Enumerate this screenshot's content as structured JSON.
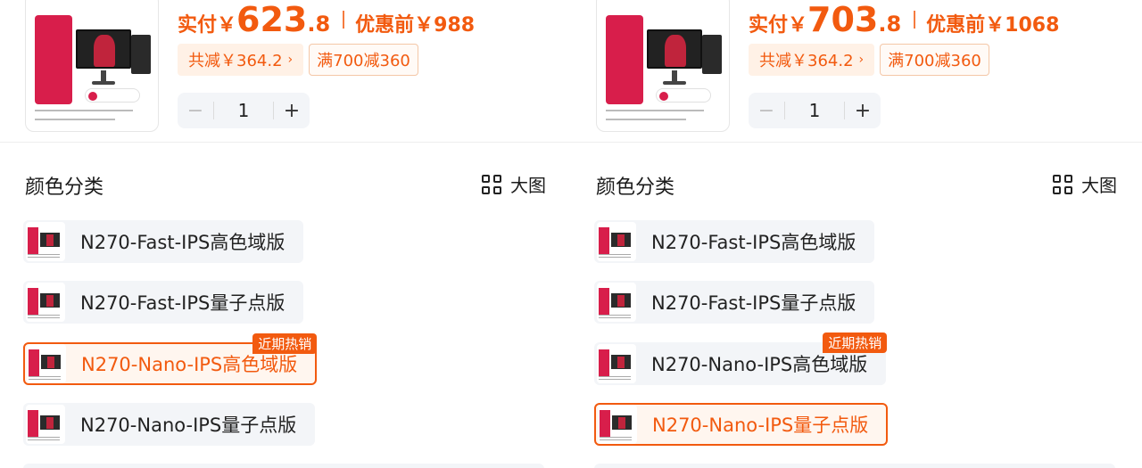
{
  "colors": {
    "accent": "#f25a0f",
    "chip_bg": "#fff1e6",
    "option_bg": "#f3f5f8",
    "brand_red": "#d81e4b"
  },
  "panels": [
    {
      "price": {
        "label": "实付￥",
        "integer": "623",
        "decimal": ".8",
        "original": "优惠前￥988"
      },
      "promo": {
        "discount": "共减￥364.2",
        "tag": "满700减360"
      },
      "quantity": "1",
      "section_title": "颜色分类",
      "big_view": "大图",
      "options": [
        {
          "label": "N270-Fast-IPS高色域版",
          "selected": false,
          "hot": ""
        },
        {
          "label": "N270-Fast-IPS量子点版",
          "selected": false,
          "hot": ""
        },
        {
          "label": "N270-Nano-IPS高色域版",
          "selected": true,
          "hot": "近期热销"
        },
        {
          "label": "N270-Nano-IPS量子点版",
          "selected": false,
          "hot": ""
        }
      ]
    },
    {
      "price": {
        "label": "实付￥",
        "integer": "703",
        "decimal": ".8",
        "original": "优惠前￥1068"
      },
      "promo": {
        "discount": "共减￥364.2",
        "tag": "满700减360"
      },
      "quantity": "1",
      "section_title": "颜色分类",
      "big_view": "大图",
      "options": [
        {
          "label": "N270-Fast-IPS高色域版",
          "selected": false,
          "hot": ""
        },
        {
          "label": "N270-Fast-IPS量子点版",
          "selected": false,
          "hot": ""
        },
        {
          "label": "N270-Nano-IPS高色域版",
          "selected": false,
          "hot": "近期热销"
        },
        {
          "label": "N270-Nano-IPS量子点版",
          "selected": true,
          "hot": ""
        }
      ]
    }
  ]
}
